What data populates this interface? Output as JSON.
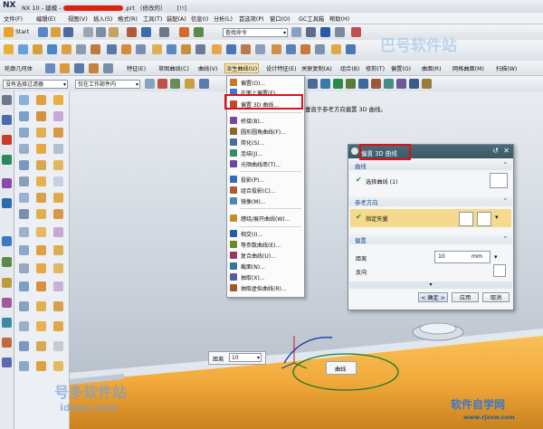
{
  "app": {
    "logo": "NX",
    "title_prefix": "NX 10 - 建模 -",
    "title_suffix": ".prt （修改的）",
    "title_tail": "[!!]"
  },
  "menubar": {
    "items": [
      "文件(F)",
      "编辑(E)",
      "视图(V)",
      "插入(S)",
      "格式(R)",
      "工具(T)",
      "装配(A)",
      "信息(I)",
      "分析(L)",
      "首选项(P)",
      "窗口(O)",
      "GC工具箱",
      "帮助(H)"
    ]
  },
  "toolbar1": {
    "start_label": "Start",
    "search_placeholder": "查找命令"
  },
  "toolbar3": {
    "items": [
      "轮廓几何体",
      "特征(E)",
      "草图曲线(C)",
      "曲线(V)",
      "派生曲线(U)",
      "设计特征(E)",
      "关联复制(A)",
      "组合(B)",
      "修剪(T)",
      "偏置(O)",
      "曲面(R)",
      "网格曲面(M)",
      "扫描(W)"
    ]
  },
  "filterbar": {
    "filter_value": "没有选择过滤器",
    "scope_value": "仅在工作部件内"
  },
  "dropdown": {
    "items": [
      {
        "label": "偏置(O)...",
        "color": "#c07a2a"
      },
      {
        "label": "在面上偏置(F)...",
        "color": "#3b7ad0"
      },
      {
        "label": "偏置 3D 曲线...",
        "color": "#c44a2a"
      },
      {
        "label": "桥接(B)...",
        "color": "#7a4a9a"
      },
      {
        "label": "圆形圆角曲线(F)...",
        "color": "#8a6a2a"
      },
      {
        "label": "简化(S)...",
        "color": "#4a6aa0"
      },
      {
        "label": "连结(J)...",
        "color": "#3a8a6a"
      },
      {
        "label": "光顺曲线串(T)...",
        "color": "#6a4a9a"
      },
      {
        "label": "投影(P)...",
        "color": "#3a6ab0"
      },
      {
        "label": "组合投影(C)...",
        "color": "#b05a3a"
      },
      {
        "label": "镜像(M)...",
        "color": "#4a8ab0"
      },
      {
        "label": "缠绕/展开曲线(W)...",
        "color": "#c0902a"
      },
      {
        "label": "相交(I)...",
        "color": "#2a5aa0"
      },
      {
        "label": "等参数曲线(E)...",
        "color": "#6a8a2a"
      },
      {
        "label": "复合曲线(U)...",
        "color": "#9a3a5a"
      },
      {
        "label": "截面(N)...",
        "color": "#2a7a9a"
      },
      {
        "label": "抽取(X)...",
        "color": "#5a5aa0"
      },
      {
        "label": "抽取虚拟曲线(R)...",
        "color": "#a05a2a"
      }
    ]
  },
  "tooltip": "垂直于参考方向偏置 3D 曲线。",
  "dialog": {
    "title": "偏置 3D 曲线",
    "sections": {
      "curve": {
        "header": "曲线",
        "row_label": "选择曲线 (1)"
      },
      "reference": {
        "header": "参考方向",
        "row_label": "指定矢量"
      },
      "offset": {
        "header": "偏置",
        "distance_label": "距离",
        "distance_value": "10",
        "unit": "mm",
        "reverse_label": "反向"
      }
    },
    "buttons": {
      "ok": "< 确定 >",
      "apply": "应用",
      "cancel": "取消"
    }
  },
  "viewport": {
    "distance_label": "距离",
    "distance_value": "10",
    "curve_label": "曲线"
  },
  "watermarks": {
    "top": "巴号软件站",
    "bottom_left": "号多软件站",
    "bottom_left_url": "idooo.com",
    "bottom_right": "软件自学网",
    "bottom_right_url": "www.rjzxw.com"
  },
  "colors": {
    "title_accent": "#3b5864",
    "highlight_red": "#e0101a",
    "check_green": "#1a9a2a",
    "selected_row": "#f5d98c",
    "solid_orange": "#f2a93a"
  }
}
